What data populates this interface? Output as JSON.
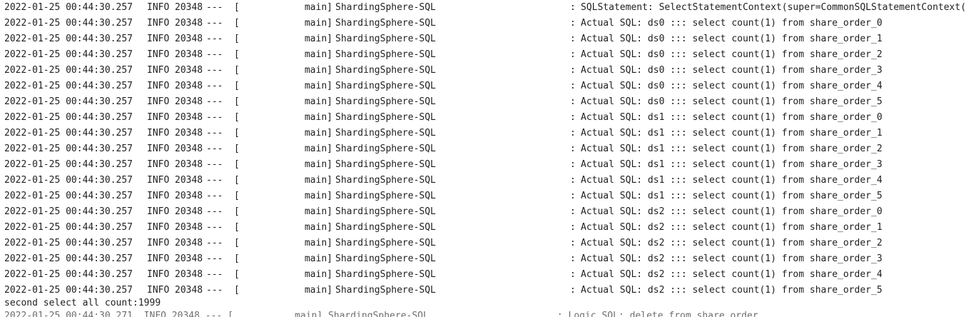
{
  "console": {
    "lines": [
      {
        "timestamp": "2022-01-25 00:44:30.257",
        "level": "INFO",
        "pid": "20348",
        "dashes": "---",
        "bracket": "[",
        "thread": "main]",
        "logger": "ShardingSphere-SQL",
        "colon": ":",
        "message": "SQLStatement: SelectStatementContext(super=CommonSQLStatementContext("
      },
      {
        "timestamp": "2022-01-25 00:44:30.257",
        "level": "INFO",
        "pid": "20348",
        "dashes": "---",
        "bracket": "[",
        "thread": "main]",
        "logger": "ShardingSphere-SQL",
        "colon": ":",
        "message": "Actual SQL: ds0 ::: select count(1) from share_order_0"
      },
      {
        "timestamp": "2022-01-25 00:44:30.257",
        "level": "INFO",
        "pid": "20348",
        "dashes": "---",
        "bracket": "[",
        "thread": "main]",
        "logger": "ShardingSphere-SQL",
        "colon": ":",
        "message": "Actual SQL: ds0 ::: select count(1) from share_order_1"
      },
      {
        "timestamp": "2022-01-25 00:44:30.257",
        "level": "INFO",
        "pid": "20348",
        "dashes": "---",
        "bracket": "[",
        "thread": "main]",
        "logger": "ShardingSphere-SQL",
        "colon": ":",
        "message": "Actual SQL: ds0 ::: select count(1) from share_order_2"
      },
      {
        "timestamp": "2022-01-25 00:44:30.257",
        "level": "INFO",
        "pid": "20348",
        "dashes": "---",
        "bracket": "[",
        "thread": "main]",
        "logger": "ShardingSphere-SQL",
        "colon": ":",
        "message": "Actual SQL: ds0 ::: select count(1) from share_order_3"
      },
      {
        "timestamp": "2022-01-25 00:44:30.257",
        "level": "INFO",
        "pid": "20348",
        "dashes": "---",
        "bracket": "[",
        "thread": "main]",
        "logger": "ShardingSphere-SQL",
        "colon": ":",
        "message": "Actual SQL: ds0 ::: select count(1) from share_order_4"
      },
      {
        "timestamp": "2022-01-25 00:44:30.257",
        "level": "INFO",
        "pid": "20348",
        "dashes": "---",
        "bracket": "[",
        "thread": "main]",
        "logger": "ShardingSphere-SQL",
        "colon": ":",
        "message": "Actual SQL: ds0 ::: select count(1) from share_order_5"
      },
      {
        "timestamp": "2022-01-25 00:44:30.257",
        "level": "INFO",
        "pid": "20348",
        "dashes": "---",
        "bracket": "[",
        "thread": "main]",
        "logger": "ShardingSphere-SQL",
        "colon": ":",
        "message": "Actual SQL: ds1 ::: select count(1) from share_order_0"
      },
      {
        "timestamp": "2022-01-25 00:44:30.257",
        "level": "INFO",
        "pid": "20348",
        "dashes": "---",
        "bracket": "[",
        "thread": "main]",
        "logger": "ShardingSphere-SQL",
        "colon": ":",
        "message": "Actual SQL: ds1 ::: select count(1) from share_order_1"
      },
      {
        "timestamp": "2022-01-25 00:44:30.257",
        "level": "INFO",
        "pid": "20348",
        "dashes": "---",
        "bracket": "[",
        "thread": "main]",
        "logger": "ShardingSphere-SQL",
        "colon": ":",
        "message": "Actual SQL: ds1 ::: select count(1) from share_order_2"
      },
      {
        "timestamp": "2022-01-25 00:44:30.257",
        "level": "INFO",
        "pid": "20348",
        "dashes": "---",
        "bracket": "[",
        "thread": "main]",
        "logger": "ShardingSphere-SQL",
        "colon": ":",
        "message": "Actual SQL: ds1 ::: select count(1) from share_order_3"
      },
      {
        "timestamp": "2022-01-25 00:44:30.257",
        "level": "INFO",
        "pid": "20348",
        "dashes": "---",
        "bracket": "[",
        "thread": "main]",
        "logger": "ShardingSphere-SQL",
        "colon": ":",
        "message": "Actual SQL: ds1 ::: select count(1) from share_order_4"
      },
      {
        "timestamp": "2022-01-25 00:44:30.257",
        "level": "INFO",
        "pid": "20348",
        "dashes": "---",
        "bracket": "[",
        "thread": "main]",
        "logger": "ShardingSphere-SQL",
        "colon": ":",
        "message": "Actual SQL: ds1 ::: select count(1) from share_order_5"
      },
      {
        "timestamp": "2022-01-25 00:44:30.257",
        "level": "INFO",
        "pid": "20348",
        "dashes": "---",
        "bracket": "[",
        "thread": "main]",
        "logger": "ShardingSphere-SQL",
        "colon": ":",
        "message": "Actual SQL: ds2 ::: select count(1) from share_order_0"
      },
      {
        "timestamp": "2022-01-25 00:44:30.257",
        "level": "INFO",
        "pid": "20348",
        "dashes": "---",
        "bracket": "[",
        "thread": "main]",
        "logger": "ShardingSphere-SQL",
        "colon": ":",
        "message": "Actual SQL: ds2 ::: select count(1) from share_order_1"
      },
      {
        "timestamp": "2022-01-25 00:44:30.257",
        "level": "INFO",
        "pid": "20348",
        "dashes": "---",
        "bracket": "[",
        "thread": "main]",
        "logger": "ShardingSphere-SQL",
        "colon": ":",
        "message": "Actual SQL: ds2 ::: select count(1) from share_order_2"
      },
      {
        "timestamp": "2022-01-25 00:44:30.257",
        "level": "INFO",
        "pid": "20348",
        "dashes": "---",
        "bracket": "[",
        "thread": "main]",
        "logger": "ShardingSphere-SQL",
        "colon": ":",
        "message": "Actual SQL: ds2 ::: select count(1) from share_order_3"
      },
      {
        "timestamp": "2022-01-25 00:44:30.257",
        "level": "INFO",
        "pid": "20348",
        "dashes": "---",
        "bracket": "[",
        "thread": "main]",
        "logger": "ShardingSphere-SQL",
        "colon": ":",
        "message": "Actual SQL: ds2 ::: select count(1) from share_order_4"
      },
      {
        "timestamp": "2022-01-25 00:44:30.257",
        "level": "INFO",
        "pid": "20348",
        "dashes": "---",
        "bracket": "[",
        "thread": "main]",
        "logger": "ShardingSphere-SQL",
        "colon": ":",
        "message": "Actual SQL: ds2 ::: select count(1) from share_order_5"
      }
    ],
    "summary": "second select all count:1999",
    "partial_line": "2022-01-25 00:44:30.271  INFO 20348 --- [           main] ShardingSphere-SQL                       : Logic SQL: delete from share_order"
  }
}
